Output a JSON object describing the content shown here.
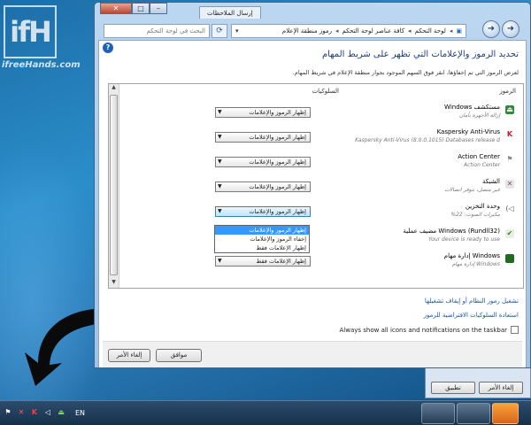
{
  "branding": {
    "logo_text": "ifH",
    "site": "ifreeHands.com"
  },
  "window": {
    "title_tab": "إرسال الملاحظات",
    "caption_min": "–",
    "caption_max": "□",
    "caption_close": "✕",
    "search_placeholder": "البحث في لوحة التحكم",
    "breadcrumb": [
      "لوحة التحكم",
      "كافة عناصر لوحة التحكم",
      "رموز منطقة الإعلام"
    ],
    "heading": "تحديد الرموز والإعلامات التي تظهر على شريط المهام",
    "description": "لعرض الرموز التي تم إخفاؤها، انقر فوق السهم الموجود بجوار منطقة الإعلام في شريط المهام."
  },
  "table": {
    "col_icons": "الرموز",
    "col_behaviors": "السلوكيات",
    "rows": [
      {
        "name": "مستكشف Windows",
        "sub": "إزالة الأجهزة بأمان",
        "value": "إظهار الرموز والإعلامات",
        "icon_color": "#2e8b3a",
        "icon": "usb-icon"
      },
      {
        "name": "Kaspersky Anti-Virus",
        "sub": "Kaspersky Anti-Virus (8.0.0.1015) Databases release d",
        "value": "إظهار الرموز والإعلامات",
        "icon_color": "#c8102e",
        "icon": "kaspersky-icon"
      },
      {
        "name": "Action Center",
        "sub": "Action Center",
        "value": "إظهار الرموز والإعلامات",
        "icon_color": "#888888",
        "icon": "flag-icon"
      },
      {
        "name": "الشبكة",
        "sub": "غير متصل، تتوفر اتصالات",
        "value": "إظهار الرموز والإعلامات",
        "icon_color": "#c0392b",
        "icon": "network-icon"
      },
      {
        "name": "وحدة التخزين",
        "sub": "مكبرات الصوت: 22%",
        "value": "إظهار الرموز والإعلامات",
        "icon_color": "#555555",
        "icon": "speaker-icon"
      },
      {
        "name": "Windows (Rundll32) مضيف عملية",
        "sub": "Your device is ready to use",
        "value": "",
        "icon_color": "#3a7d2c",
        "icon": "device-icon"
      },
      {
        "name": "Windows إدارة مهام",
        "sub": "Windows إدارة مهام",
        "value": "إظهار الإعلامات فقط",
        "icon_color": "#2a8a2a",
        "icon": "task-manager-icon"
      }
    ],
    "dropdown_options": [
      "إظهار الرموز والإعلامات",
      "إخفاء الرموز والإعلامات",
      "إظهار الإعلامات فقط"
    ],
    "dropdown_selected_index": 0
  },
  "links": {
    "system_icons": "تشغيل رموز النظام أو إيقاف تشغيلها",
    "restore_defaults": "استعادة السلوكيات الافتراضية للرموز"
  },
  "always_show": {
    "label": "Always show all icons and notifications on the taskbar",
    "checked": false
  },
  "footer": {
    "ok": "موافق",
    "cancel": "إلغاء الأمر"
  },
  "background_window": {
    "apply": "تطبيق",
    "cancel": "إلغاء الأمر"
  },
  "taskbar": {
    "language": "EN"
  }
}
